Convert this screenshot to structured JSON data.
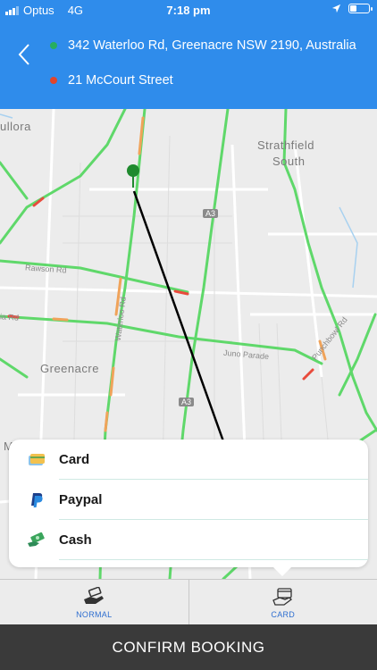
{
  "status_bar": {
    "carrier": "Optus",
    "network": "4G",
    "time": "7:18 pm",
    "battery_level": 0.35
  },
  "header": {
    "back_icon": "chevron-left-icon",
    "pickup_address": "342 Waterloo Rd, Greenacre NSW 2190, Australia",
    "dropoff_address": "21 McCourt Street",
    "pickup_color": "#27ae60",
    "dropoff_color": "#e0452b"
  },
  "map": {
    "labels": {
      "bullora": "ullora",
      "strathfield": "Strathfield",
      "south": "South",
      "greenacre": "Greenacre",
      "m_letter": "M"
    },
    "road_badges": [
      "A3",
      "A3"
    ],
    "streets": {
      "rawson": "Rawson Rd",
      "waterloo": "Waterloo Rd",
      "juno": "Juno Parade",
      "roberts": "Roberts Rd",
      "cooks": "Punchbowl Rd",
      "rd_left": "ia Rd"
    }
  },
  "payment_options": [
    {
      "label": "Card",
      "icon": "credit-card-icon"
    },
    {
      "label": "Paypal",
      "icon": "paypal-icon"
    },
    {
      "label": "Cash",
      "icon": "cash-icon"
    }
  ],
  "ride_options": [
    {
      "label": "NORMAL",
      "icon": "hand-coin-icon"
    },
    {
      "label": "CARD",
      "icon": "hand-card-icon"
    }
  ],
  "confirm_label": "CONFIRM BOOKING",
  "colors": {
    "primary": "#2f8ceb",
    "traffic_green": "#5fd86a",
    "traffic_orange": "#f0a35a",
    "traffic_red": "#e84b3c",
    "route_line": "#000000",
    "confirm_bg": "#3a3a3a"
  }
}
